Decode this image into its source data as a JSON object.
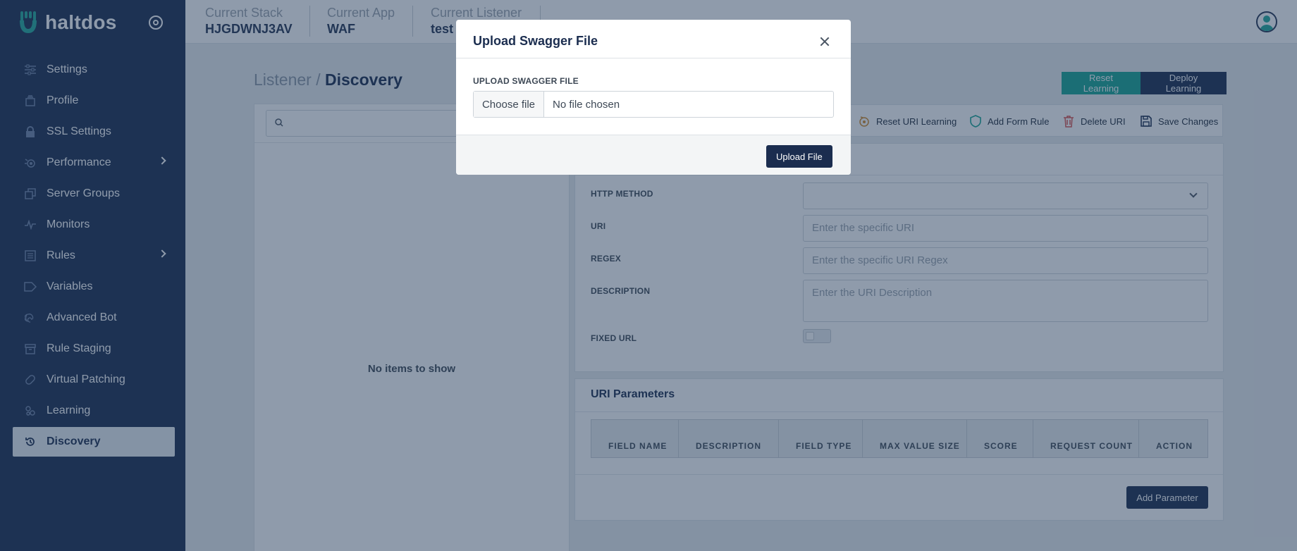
{
  "brand": {
    "name": "haltdos"
  },
  "sidebar": {
    "items": [
      {
        "label": "Settings",
        "icon": "sliders-icon",
        "has_submenu": false
      },
      {
        "label": "Profile",
        "icon": "profile-icon",
        "has_submenu": false
      },
      {
        "label": "SSL Settings",
        "icon": "lock-icon",
        "has_submenu": false
      },
      {
        "label": "Performance",
        "icon": "gear-icon",
        "has_submenu": true
      },
      {
        "label": "Server Groups",
        "icon": "server-groups-icon",
        "has_submenu": false
      },
      {
        "label": "Monitors",
        "icon": "pulse-icon",
        "has_submenu": false
      },
      {
        "label": "Rules",
        "icon": "list-icon",
        "has_submenu": true
      },
      {
        "label": "Variables",
        "icon": "tag-icon",
        "has_submenu": false
      },
      {
        "label": "Advanced Bot",
        "icon": "fingerprint-icon",
        "has_submenu": false
      },
      {
        "label": "Rule Staging",
        "icon": "archive-icon",
        "has_submenu": false
      },
      {
        "label": "Virtual Patching",
        "icon": "patch-icon",
        "has_submenu": false
      },
      {
        "label": "Learning",
        "icon": "learning-icon",
        "has_submenu": false
      },
      {
        "label": "Discovery",
        "icon": "history-icon",
        "has_submenu": false,
        "active": true
      }
    ]
  },
  "topbar": {
    "current_stack_label": "Current Stack",
    "current_stack_value": "HJGDWNJ3AV",
    "current_app_label": "Current App",
    "current_app_value": "WAF",
    "current_listener_label": "Current Listener",
    "current_listener_value": "test"
  },
  "page": {
    "breadcrumb_parent": "Listener /",
    "breadcrumb_current": "Discovery",
    "reset_learning_label": "Reset Learning",
    "deploy_learning_label": "Deploy Learning"
  },
  "left_panel": {
    "search_placeholder": "",
    "empty_message": "No items to show"
  },
  "toolbar": {
    "reset_uri_learning": "Reset URI Learning",
    "add_form_rule": "Add Form Rule",
    "delete_uri": "Delete URI",
    "save_changes": "Save Changes"
  },
  "form": {
    "http_method_label": "HTTP METHOD",
    "http_method_value": "",
    "uri_label": "URI",
    "uri_placeholder": "Enter the specific URI",
    "regex_label": "REGEX",
    "regex_placeholder": "Enter the specific URI Regex",
    "description_label": "DESCRIPTION",
    "description_placeholder": "Enter the URI Description",
    "fixed_url_label": "FIXED URL",
    "fixed_url_on": false
  },
  "params": {
    "title": "URI Parameters",
    "columns": [
      "FIELD NAME",
      "DESCRIPTION",
      "FIELD TYPE",
      "MAX VALUE SIZE",
      "SCORE",
      "REQUEST COUNT",
      "ACTION"
    ],
    "add_label": "Add Parameter"
  },
  "modal": {
    "title": "Upload Swagger File",
    "field_label": "UPLOAD SWAGGER FILE",
    "choose_file_label": "Choose file",
    "file_status": "No file chosen",
    "upload_label": "Upload File"
  },
  "colors": {
    "sidebar_bg": "#1b2d4f",
    "accent_teal": "#17a493",
    "navy": "#1b2d4f",
    "overlay": "rgba(31,55,88,0.5)"
  }
}
